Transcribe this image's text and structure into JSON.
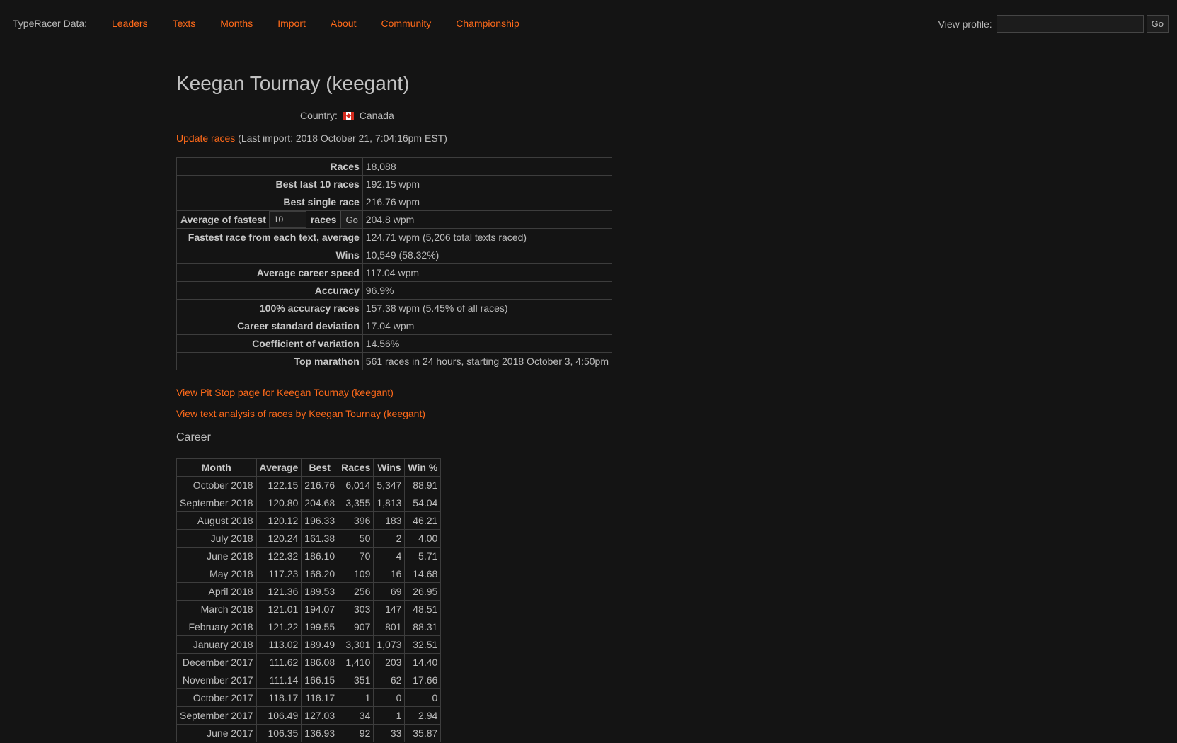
{
  "nav": {
    "brand": "TypeRacer Data:",
    "links": [
      "Leaders",
      "Texts",
      "Months",
      "Import",
      "About",
      "Community",
      "Championship"
    ],
    "view_profile_label": "View profile:",
    "view_profile_value": "",
    "go_label": "Go"
  },
  "profile": {
    "title": "Keegan Tournay (keegant)",
    "country_label": "Country:",
    "country": "Canada",
    "update_link": "Update races",
    "last_import": "(Last import: 2018 October 21, 7:04:16pm EST)"
  },
  "stats": [
    {
      "label": "Races",
      "value": "18,088"
    },
    {
      "label": "Best last 10 races",
      "value": "192.15 wpm"
    },
    {
      "label": "Best single race",
      "value": "216.76 wpm"
    },
    {
      "label": "AVG",
      "value": "204.8 wpm"
    },
    {
      "label": "Fastest race from each text, average",
      "value": "124.71 wpm (5,206 total texts raced)"
    },
    {
      "label": "Wins",
      "value": "10,549 (58.32%)"
    },
    {
      "label": "Average career speed",
      "value": "117.04 wpm"
    },
    {
      "label": "Accuracy",
      "value": "96.9%"
    },
    {
      "label": "100% accuracy races",
      "value": "157.38 wpm (5.45% of all races)"
    },
    {
      "label": "Career standard deviation",
      "value": "17.04 wpm"
    },
    {
      "label": "Coefficient of variation",
      "value": "14.56%"
    },
    {
      "label": "Top marathon",
      "value": "561 races in 24 hours, starting 2018 October 3, 4:50pm"
    }
  ],
  "avg_fastest": {
    "label_before": "Average of fastest",
    "input_value": "10",
    "label_after": "races",
    "go_label": "Go"
  },
  "links": {
    "pit_stop": "View Pit Stop page for Keegan Tournay (keegant)",
    "text_analysis": "View text analysis of races by Keegan Tournay (keegant)"
  },
  "career": {
    "heading": "Career",
    "columns": [
      "Month",
      "Average",
      "Best",
      "Races",
      "Wins",
      "Win %"
    ],
    "rows": [
      [
        "October 2018",
        "122.15",
        "216.76",
        "6,014",
        "5,347",
        "88.91"
      ],
      [
        "September 2018",
        "120.80",
        "204.68",
        "3,355",
        "1,813",
        "54.04"
      ],
      [
        "August 2018",
        "120.12",
        "196.33",
        "396",
        "183",
        "46.21"
      ],
      [
        "July 2018",
        "120.24",
        "161.38",
        "50",
        "2",
        "4.00"
      ],
      [
        "June 2018",
        "122.32",
        "186.10",
        "70",
        "4",
        "5.71"
      ],
      [
        "May 2018",
        "117.23",
        "168.20",
        "109",
        "16",
        "14.68"
      ],
      [
        "April 2018",
        "121.36",
        "189.53",
        "256",
        "69",
        "26.95"
      ],
      [
        "March 2018",
        "121.01",
        "194.07",
        "303",
        "147",
        "48.51"
      ],
      [
        "February 2018",
        "121.22",
        "199.55",
        "907",
        "801",
        "88.31"
      ],
      [
        "January 2018",
        "113.02",
        "189.49",
        "3,301",
        "1,073",
        "32.51"
      ],
      [
        "December 2017",
        "111.62",
        "186.08",
        "1,410",
        "203",
        "14.40"
      ],
      [
        "November 2017",
        "111.14",
        "166.15",
        "351",
        "62",
        "17.66"
      ],
      [
        "October 2017",
        "118.17",
        "118.17",
        "1",
        "0",
        "0"
      ],
      [
        "September 2017",
        "106.49",
        "127.03",
        "34",
        "1",
        "2.94"
      ],
      [
        "June 2017",
        "106.35",
        "136.93",
        "92",
        "33",
        "35.87"
      ]
    ]
  },
  "colors": {
    "background": "#141414",
    "link": "#ff6a1a",
    "text": "#bdbdbd",
    "border": "#3d3d3d"
  }
}
